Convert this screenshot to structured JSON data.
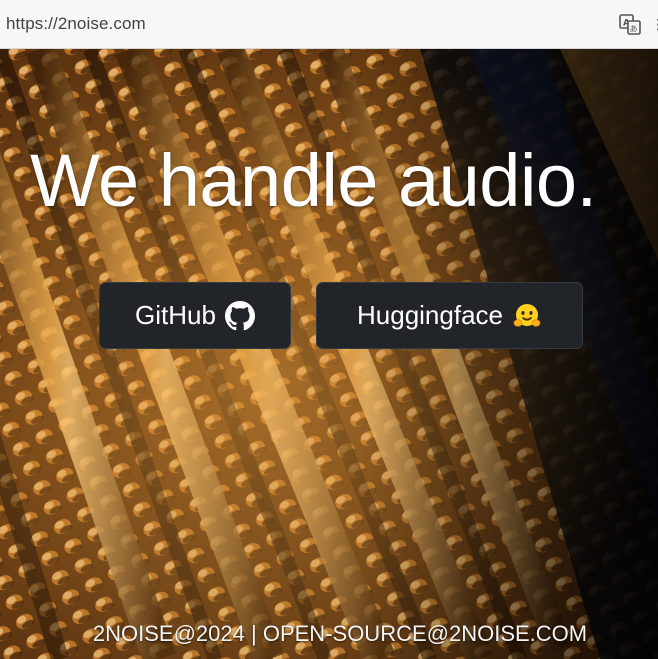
{
  "browser": {
    "url": "https://2noise.com",
    "icons": [
      "translate-icon",
      "more-icon"
    ]
  },
  "hero": {
    "headline": "We handle audio.",
    "background": "audio-waveform-terrain",
    "buttons": [
      {
        "label": "GitHub",
        "icon": "github-icon"
      },
      {
        "label": "Huggingface",
        "icon": "huggingface-icon"
      }
    ]
  },
  "footer": {
    "copyright": "2NOISE@2024",
    "separator": "|",
    "email": "OPEN-SOURCE@2NOISE.COM"
  },
  "colors": {
    "button_bg": "#212529",
    "text": "#ffffff",
    "accent_orange": "#d98a2b",
    "hf_yellow": "#ffd21e"
  }
}
